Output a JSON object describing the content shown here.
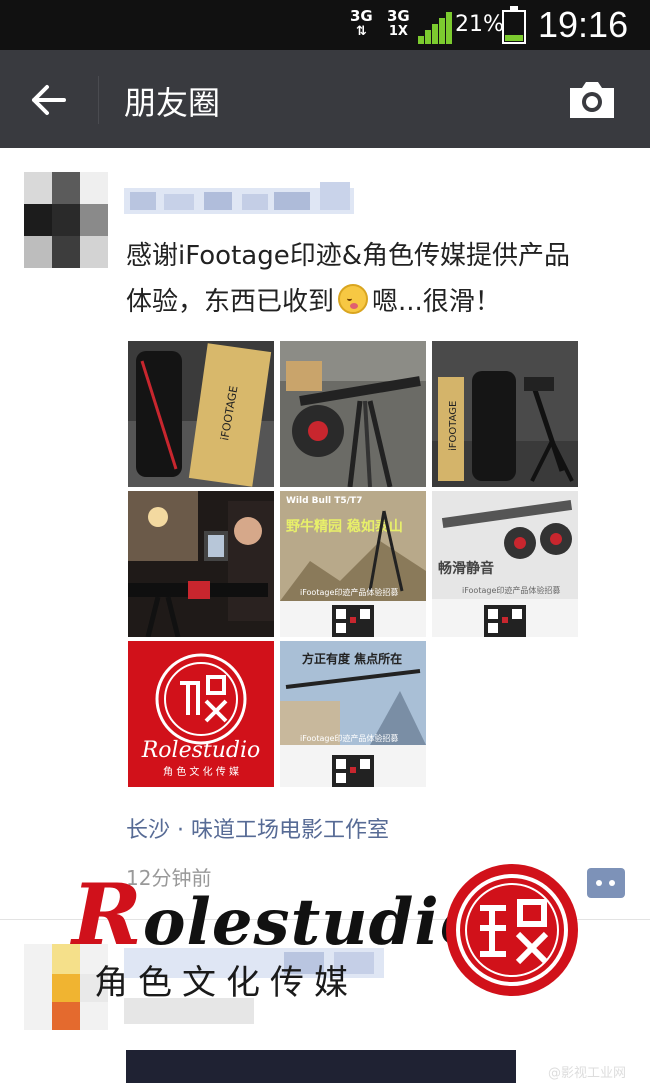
{
  "status_bar": {
    "net1": "3G",
    "net1_sub": "⇅",
    "net2": "3G",
    "net2_sub": "1X",
    "battery_pct": "21%",
    "battery_level": 0.21,
    "time": "19:16",
    "accent": "#7ccb2f"
  },
  "navbar": {
    "title": "朋友圈",
    "back_icon": "arrow-left-icon",
    "camera_icon": "camera-icon",
    "background": "#393a3f"
  },
  "post": {
    "text_line1": "感谢iFootage印迹&角色传媒提供产品",
    "text_line2_a": "体验，东西已收到",
    "text_line2_b": "嗯...很滑！",
    "emoji_icon": "blushing-face-emoji",
    "images": [
      {
        "label": "iFOOTAGE"
      },
      {
        "label": ""
      },
      {
        "label": "iFOOTAGE"
      },
      {
        "label": ""
      },
      {
        "label": "Wild Bull T5/T7",
        "headline": "野牛精园 稳如泰山",
        "caption": "iFootage印迹产品体验招募"
      },
      {
        "label": "",
        "headline": "畅滑静音",
        "caption": "iFootage印迹产品体验招募"
      },
      {
        "label": "Rolestudio",
        "sub": "角 色 文 化 传 媒"
      },
      {
        "label": "",
        "headline": "方正有度 焦点所在",
        "caption": "iFootage印迹产品体验招募"
      }
    ],
    "location": "长沙 · 味道工场电影工作室",
    "time_ago": "12分钟前",
    "link_color": "#576b95"
  },
  "watermark": {
    "brand_r": "R",
    "brand_rest": "olestudio",
    "sub": "角色文化传媒",
    "site": "@影视工业网"
  }
}
